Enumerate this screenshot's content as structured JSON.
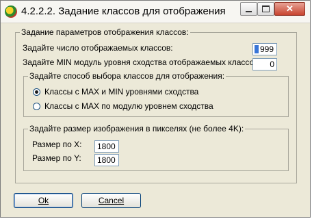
{
  "window": {
    "title": "4.2.2.2. Задание классов для отображения",
    "icon": "app-logo-icon",
    "close_glyph": "✕"
  },
  "main_group": {
    "legend": "Задание параметров отображения классов:",
    "class_count": {
      "label": "Задайте число отображаемых классов:",
      "value": "999"
    },
    "min_similarity": {
      "label": "Задайте MIN модуль уровня сходства отображаемых классов:",
      "value": "0"
    }
  },
  "selection_group": {
    "legend": "Задайте способ выбора классов для отображения:",
    "options": [
      {
        "label": "Классы с MAX и MIN уровнями сходства",
        "checked": true
      },
      {
        "label": "Классы с MAX по модулю уровнем сходства",
        "checked": false
      }
    ]
  },
  "size_group": {
    "legend": "Задайте размер изображения в пикселях (не более 4K):",
    "size_x": {
      "label": "Размер по X:",
      "value": "1800"
    },
    "size_y": {
      "label": "Размер по Y:",
      "value": "1800"
    }
  },
  "buttons": {
    "ok": "Ok",
    "cancel": "Cancel"
  },
  "colors": {
    "dialog_background": "#ece9d8",
    "close_button": "#c8442f",
    "input_border": "#7f9db9",
    "selection_caret": "#3875d7"
  }
}
